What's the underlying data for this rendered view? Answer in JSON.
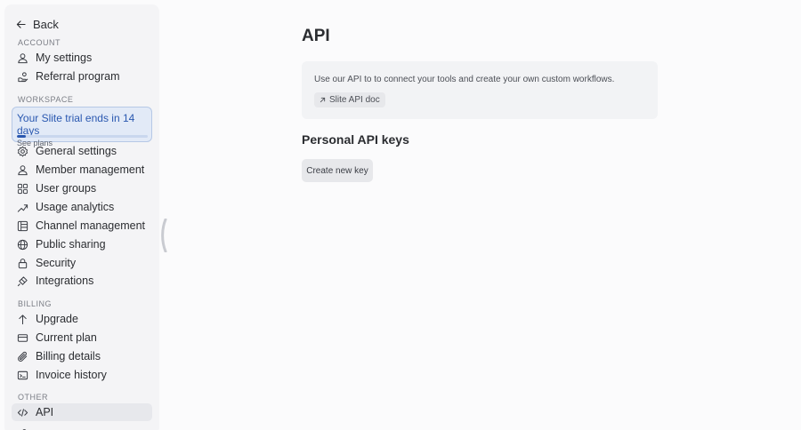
{
  "sidebar": {
    "back_label": "Back",
    "account": {
      "title": "ACCOUNT",
      "items": [
        {
          "label": "My settings",
          "icon": "user-icon"
        },
        {
          "label": "Referral program",
          "icon": "referral-icon"
        }
      ]
    },
    "workspace": {
      "title": "WORKSPACE",
      "trial": {
        "title": "Your Slite trial ends in 14 days",
        "subtitle": "See plans",
        "progress": 0.07
      },
      "items": [
        {
          "label": "General settings",
          "icon": "gear-icon"
        },
        {
          "label": "Member management",
          "icon": "user-icon"
        },
        {
          "label": "User groups",
          "icon": "user-groups-icon"
        },
        {
          "label": "Usage analytics",
          "icon": "trend-icon"
        },
        {
          "label": "Channel management",
          "icon": "channel-icon"
        },
        {
          "label": "Public sharing",
          "icon": "globe-icon"
        },
        {
          "label": "Security",
          "icon": "lock-icon"
        },
        {
          "label": "Integrations",
          "icon": "integrations-icon"
        }
      ]
    },
    "billing": {
      "title": "BILLING",
      "items": [
        {
          "label": "Upgrade",
          "icon": "arrow-up-icon"
        },
        {
          "label": "Current plan",
          "icon": "credit-card-icon"
        },
        {
          "label": "Billing details",
          "icon": "paperclip-icon"
        },
        {
          "label": "Invoice history",
          "icon": "invoice-icon"
        }
      ]
    },
    "other": {
      "title": "OTHER",
      "items": [
        {
          "label": "API",
          "icon": "code-icon",
          "active": true
        }
      ]
    }
  },
  "main": {
    "title": "API",
    "info_text": "Use our API to to connect your tools and create your own custom workflows.",
    "doc_link": "Slite API doc",
    "keys_heading": "Personal API keys",
    "create_button": "Create new key"
  },
  "colors": {
    "accent": "#2a58b0",
    "sidebar_bg": "#f4f4f6",
    "trial_bg": "#e2eaf7"
  }
}
